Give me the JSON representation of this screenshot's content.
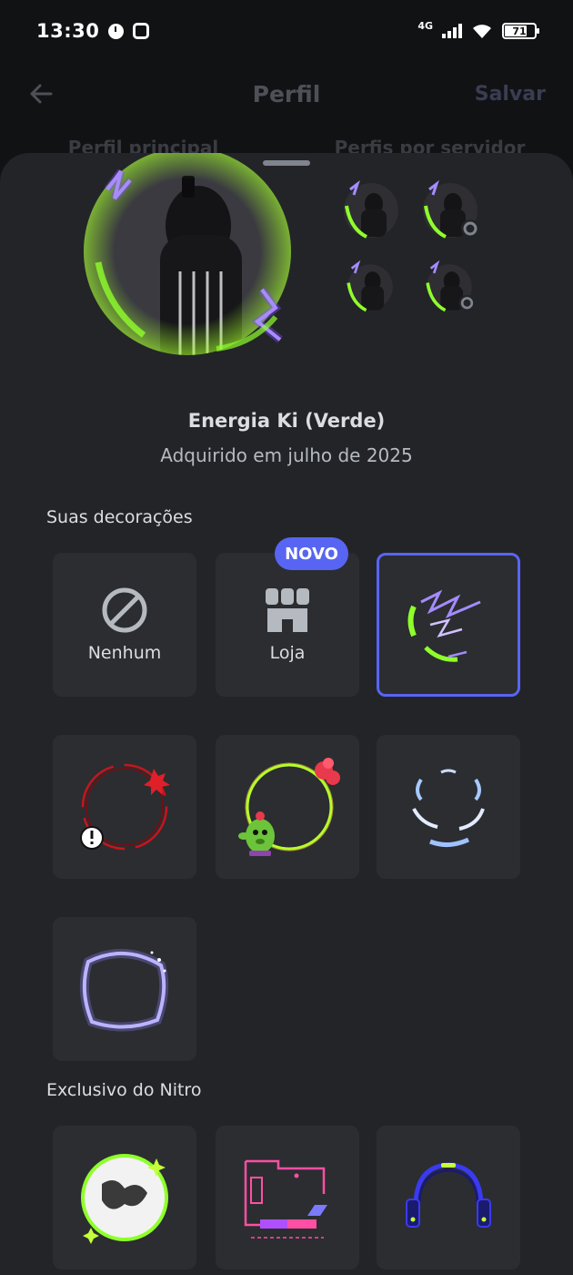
{
  "status_bar": {
    "time": "13:30",
    "network": "4G",
    "battery": "71"
  },
  "header": {
    "title": "Perfil",
    "save_label": "Salvar",
    "tabs": [
      "Perfil principal",
      "Perfis por servidor"
    ]
  },
  "selected_item": {
    "name": "Energia Ki (Verde)",
    "subtitle": "Adquirido em julho de 2025"
  },
  "your_decorations": {
    "label": "Suas decorações",
    "none_label": "Nenhum",
    "shop_label": "Loja",
    "new_badge": "NOVO"
  },
  "nitro_section": {
    "label": "Exclusivo do Nitro"
  },
  "colors": {
    "accent": "#5865f2",
    "sheet": "#232428",
    "tile": "#2b2d31"
  }
}
